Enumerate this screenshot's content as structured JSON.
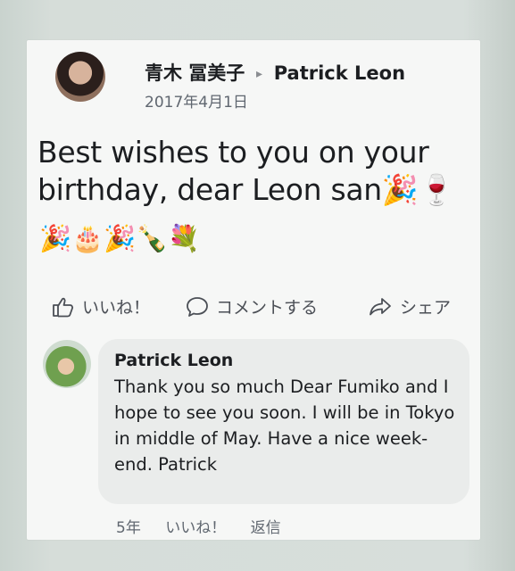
{
  "post": {
    "author": "青木 冨美子",
    "arrow": "▸",
    "recipient": "Patrick Leon",
    "date": "2017年4月1日",
    "text": "Best wishes to you on your birthday, dear Leon san🎉🍷",
    "emojis": "🎉🎂🎉🍾💐"
  },
  "actions": {
    "like": "いいね！",
    "comment": "コメントする",
    "share": "シェア"
  },
  "comment": {
    "author": "Patrick Leon",
    "text": "Thank you so much Dear Fumiko and I hope to see you soon. I will be in Tokyo in middle of May. Have a nice week-end. Patrick",
    "time": "5年",
    "like": "いいね！",
    "reply": "返信"
  }
}
